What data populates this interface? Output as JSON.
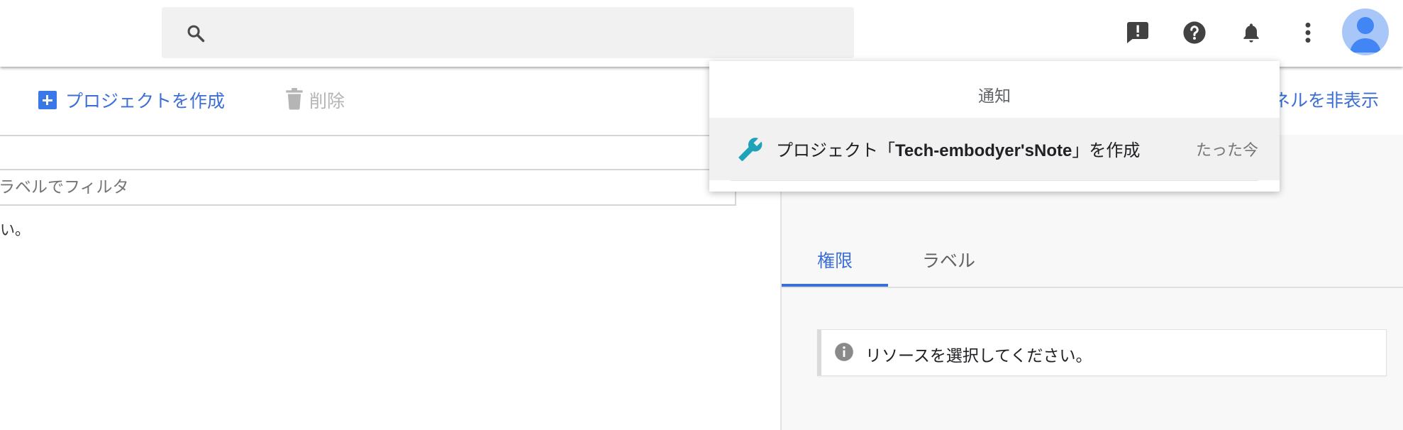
{
  "search": {
    "value": "",
    "placeholder": ""
  },
  "header_icons": [
    "feedback-icon",
    "help-icon",
    "notifications-icon",
    "more-vert-icon",
    "account-avatar"
  ],
  "toolbar": {
    "create_label": "プロジェクトを作成",
    "delete_label": "削除",
    "hide_panel_label": "ネルを非表示"
  },
  "filter": {
    "placeholder": "ラベルでフィルタ"
  },
  "left_note": "い。",
  "right_panel": {
    "tabs": [
      {
        "label": "権限",
        "active": true
      },
      {
        "label": "ラベル",
        "active": false
      }
    ],
    "info_message": "リソースを選択してください。"
  },
  "notifications": {
    "title": "通知",
    "items": [
      {
        "icon": "wrench-icon",
        "text_prefix": "プロジェクト「",
        "text_bold": "Tech-embodyer'sNote",
        "text_suffix": "」を作成",
        "time": "たった今"
      }
    ]
  },
  "colors": {
    "accent": "#3b6fd6",
    "create_icon": "#3b78e7",
    "wrench": "#1fa3b8",
    "avatar_bg": "#a8c7f8",
    "avatar_fg": "#4285f4"
  }
}
